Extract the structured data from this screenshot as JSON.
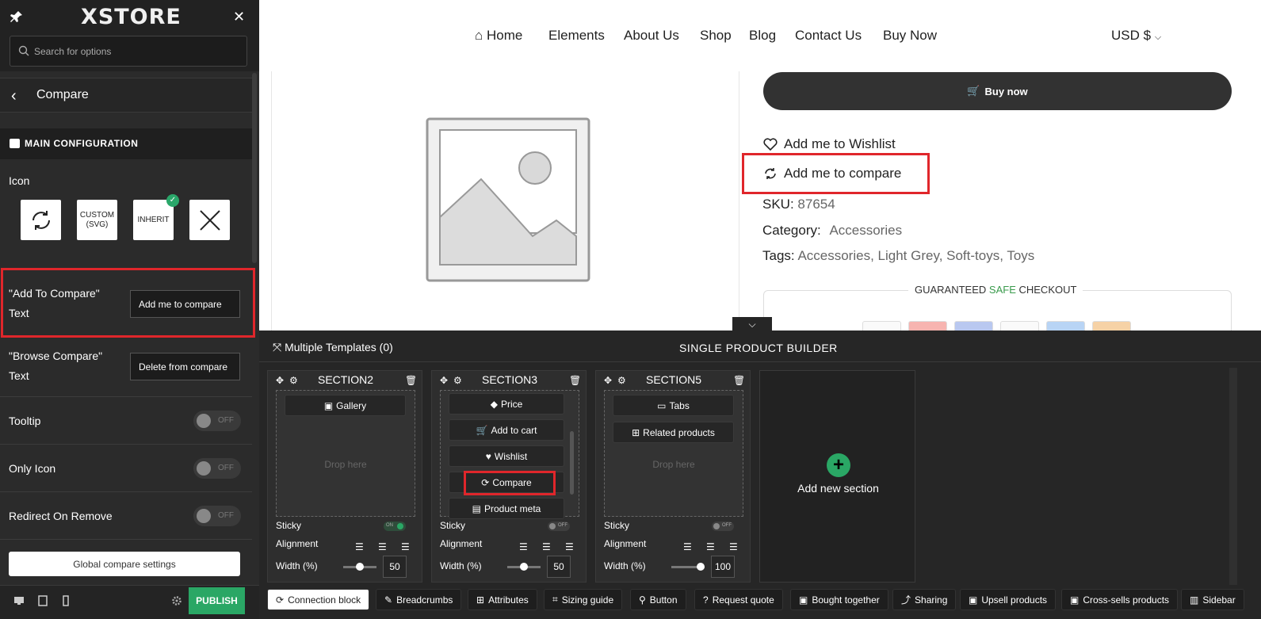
{
  "panel": {
    "logo": "XSTORE",
    "search_placeholder": "Search for options",
    "section_title": "Compare",
    "main_config_label": "MAIN CONFIGURATION",
    "icon_label": "Icon",
    "icon_options": [
      "CUSTOM (SVG)",
      "INHERIT"
    ],
    "add_to_compare_label_line1": "\"Add To Compare\"",
    "add_to_compare_label_line2": "Text",
    "add_to_compare_value": "Add me to compare",
    "browse_compare_label_line1": "\"Browse Compare\"",
    "browse_compare_label_line2": "Text",
    "browse_compare_value": "Delete from compare",
    "toggles": [
      {
        "label": "Tooltip",
        "state": "OFF"
      },
      {
        "label": "Only Icon",
        "state": "OFF"
      },
      {
        "label": "Redirect On Remove",
        "state": "OFF"
      }
    ],
    "global_button": "Global compare settings",
    "publish": "PUBLISH"
  },
  "site": {
    "nav": [
      "Home",
      "Elements",
      "About Us",
      "Shop",
      "Blog",
      "Contact Us",
      "Buy Now"
    ],
    "currency": "USD $",
    "buy_now": "Buy now",
    "wishlist": "Add me to Wishlist",
    "compare": "Add me to compare",
    "sku_label": "SKU:",
    "sku_value": "87654",
    "category_label": "Category:",
    "category_value": "Accessories",
    "tags_label": "Tags:",
    "tags_value": "Accessories, Light Grey, Soft-toys, Toys",
    "checkout_pre": "GUARANTEED ",
    "checkout_safe": "SAFE",
    "checkout_post": " CHECKOUT"
  },
  "builder": {
    "multiple_templates": "Multiple Templates (0)",
    "title": "SINGLE PRODUCT BUILDER",
    "sections": [
      {
        "name": "SECTION2",
        "blocks": [
          "Gallery"
        ],
        "sticky": "ON",
        "width": "50"
      },
      {
        "name": "SECTION3",
        "blocks": [
          "Price",
          "Add to cart",
          "Wishlist",
          "Compare",
          "Product meta"
        ],
        "sticky": "OFF",
        "width": "50"
      },
      {
        "name": "SECTION5",
        "blocks": [
          "Tabs",
          "Related products"
        ],
        "sticky": "OFF",
        "width": "100"
      }
    ],
    "drop_here": "Drop here",
    "sticky_label": "Sticky",
    "alignment_label": "Alignment",
    "width_label": "Width (%)",
    "add_section": "Add new section",
    "chips": [
      "Connection block",
      "Breadcrumbs",
      "Attributes",
      "Sizing guide",
      "Button",
      "Request quote",
      "Bought together",
      "Sharing",
      "Upsell products",
      "Cross-sells products",
      "Sidebar"
    ]
  },
  "colors": {
    "highlight": "#e0262b",
    "publish_green": "#2aa765",
    "panel_bg": "#2b2b2b"
  }
}
